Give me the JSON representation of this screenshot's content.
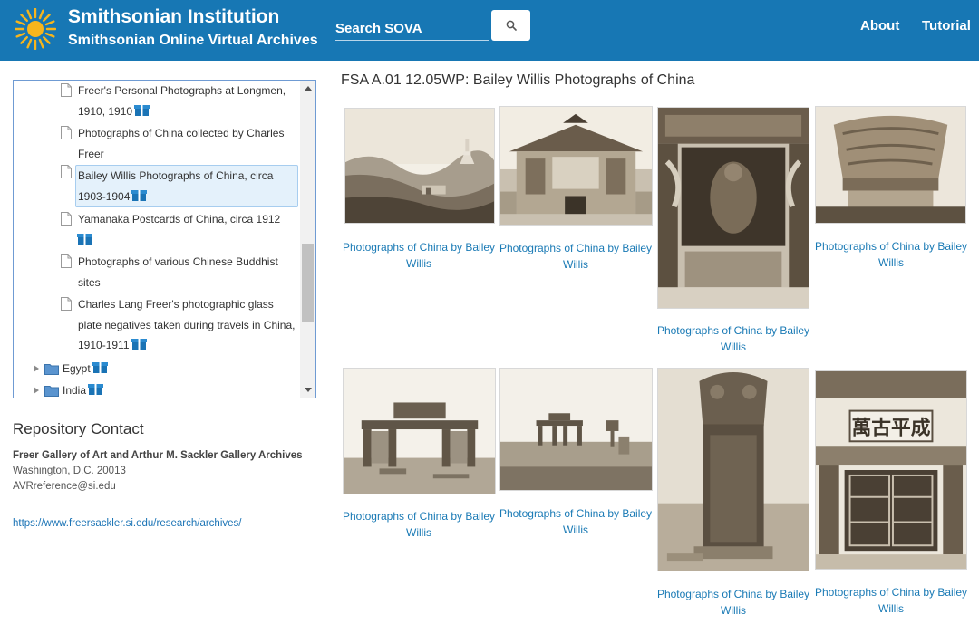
{
  "header": {
    "title": "Smithsonian Institution",
    "subtitle": "Smithsonian Online Virtual Archives",
    "search_placeholder": "Search SOVA",
    "nav": [
      "About",
      "Tutorial"
    ]
  },
  "tree": {
    "items": [
      {
        "label": "Freer's Personal Photographs at Longmen, 1910, 1910",
        "has_box": true
      },
      {
        "label": "Photographs of China collected by Charles Freer",
        "has_box": false
      },
      {
        "label": "Bailey Willis Photographs of China, circa 1903-1904",
        "has_box": true,
        "selected": true
      },
      {
        "label": "Yamanaka Postcards of China, circa 1912",
        "has_box": true
      },
      {
        "label": "Photographs of various Chinese Buddhist sites",
        "has_box": false
      },
      {
        "label": "Charles Lang Freer's photographic glass plate negatives taken during travels in China, 1910-1911",
        "has_box": true
      }
    ],
    "folders": [
      {
        "label": "Egypt"
      },
      {
        "label": "India"
      }
    ]
  },
  "repository": {
    "heading": "Repository Contact",
    "name": "Freer Gallery of Art and Arthur M. Sackler Gallery Archives",
    "city": "Washington, D.C. 20013",
    "email": "AVRreference@si.edu",
    "url": "https://www.freersackler.si.edu/research/archives/"
  },
  "main": {
    "title": "FSA A.01 12.05WP: Bailey Willis Photographs of China",
    "photos": [
      {
        "caption": "Photographs of China by Bailey Willis"
      },
      {
        "caption": "Photographs of China by Bailey Willis"
      },
      {
        "caption": "Photographs of China by Bailey Willis"
      },
      {
        "caption": "Photographs of China by Bailey Willis"
      },
      {
        "caption": "Photographs of China by Bailey Willis"
      },
      {
        "caption": "Photographs of China by Bailey Willis"
      },
      {
        "caption": "Photographs of China by Bailey Willis"
      },
      {
        "caption": "Photographs of China by Bailey Willis"
      }
    ],
    "gate_sign": "萬古平成"
  },
  "colors": {
    "header_bg": "#1777b4",
    "link": "#1a7ab5",
    "selection_bg": "#e4f1fb",
    "sepia_light": "#ede5d6",
    "sepia_dark": "#5e5242"
  }
}
